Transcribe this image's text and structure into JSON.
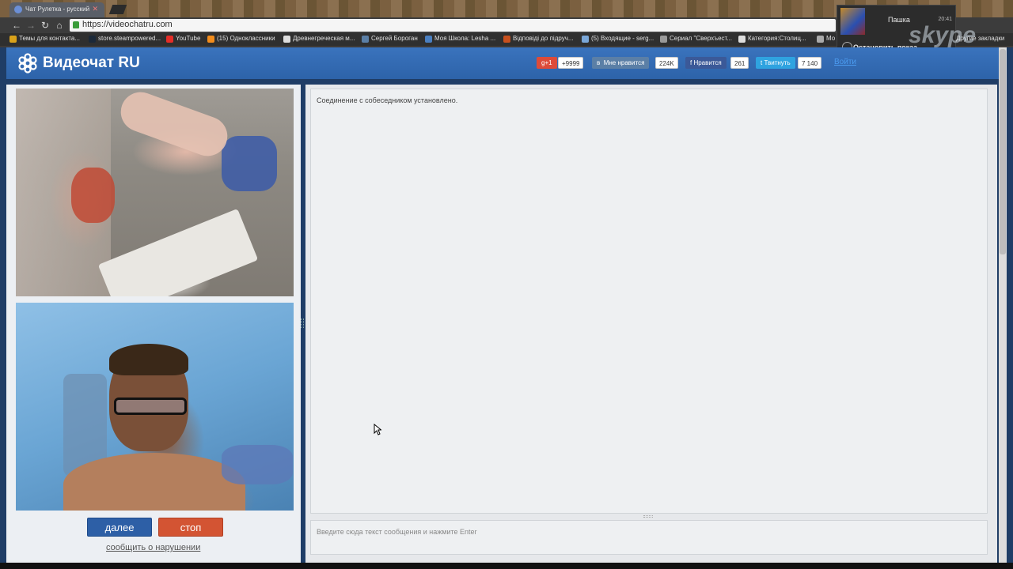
{
  "browser": {
    "tab_title": "Чат Рулетка - русский",
    "url": "https://videochatru.com",
    "bookmarks": [
      "Темы для контакта...",
      "store.steampowered...",
      "YouTube",
      "(15) Одноклассники",
      "Древнегреческая м...",
      "Сергей Бороган",
      "Моя Школа: Lesha ...",
      "Відповіді до підруч...",
      "(5) Входящие - serg...",
      "Сериал \"Сверхъест...",
      "Категория:Столиц...",
      "Мо",
      "Другие закладки"
    ]
  },
  "skype": {
    "contact_name": "Пашка",
    "time": "20:41",
    "stop_label": "Остановить показ",
    "watermark": "skype"
  },
  "header": {
    "logo_text": "Видеочат RU",
    "social": [
      {
        "label": "g+1",
        "count": "+9999",
        "color": "#dd4b39"
      },
      {
        "label": "Мне нравится",
        "count": "224K",
        "color": "#5b7fa6"
      },
      {
        "label": "Нравится",
        "count": "261",
        "color": "#3b5998"
      },
      {
        "label": "Твитнуть",
        "count": "7 140",
        "color": "#2fa3e0"
      }
    ],
    "login_label": "Войти"
  },
  "controls": {
    "next_label": "далее",
    "stop_label": "стоп",
    "report_label": "сообщить о нарушении"
  },
  "chat": {
    "status_message": "Соединение с собеседником установлено.",
    "input_placeholder": "Введите сюда текст сообщения и нажмите Enter"
  }
}
